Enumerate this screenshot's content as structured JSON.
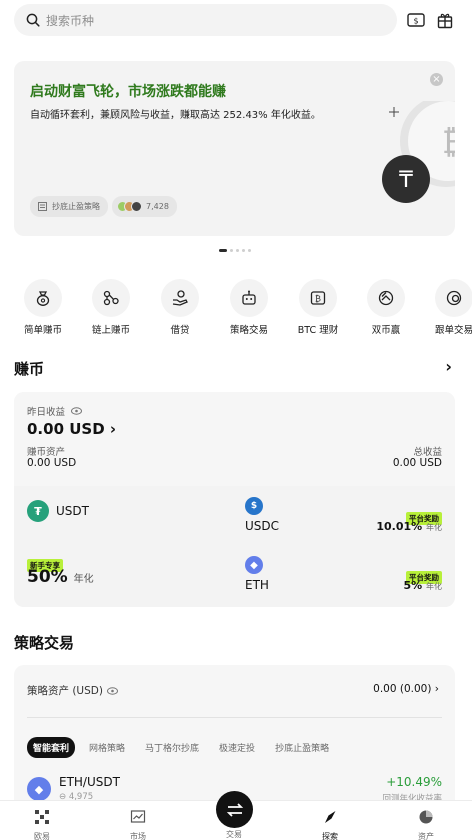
{
  "search": {
    "placeholder": "搜索币种"
  },
  "banner": {
    "title": "启动财富飞轮，市场涨跌都能赚",
    "subtitle": "自动循环套利，兼顾风险与收益，赚取高达 252.43% 年化收益。",
    "chip_label": "抄底止盈策略",
    "participants": "7,428"
  },
  "shortcuts": [
    {
      "label": "简单赚币",
      "icon": "money-bag-icon"
    },
    {
      "label": "链上赚币",
      "icon": "chain-icon"
    },
    {
      "label": "借贷",
      "icon": "loan-hand-icon"
    },
    {
      "label": "策略交易",
      "icon": "robot-icon"
    },
    {
      "label": "BTC 理财",
      "icon": "btc-wallet-icon"
    },
    {
      "label": "双币赢",
      "icon": "dual-coin-icon"
    },
    {
      "label": "跟单交易",
      "icon": "copy-trade-icon"
    }
  ],
  "earn": {
    "section_title": "赚币",
    "yesterday_label": "昨日收益",
    "yesterday_value": "0.00 USD",
    "assets_label": "赚币资产",
    "assets_value": "0.00 USD",
    "total_label": "总收益",
    "total_value": "0.00 USD",
    "products": [
      {
        "coin": "USDT",
        "badge": "新手专享",
        "apr": "50%",
        "apr_suffix": "年化",
        "color": "#26a17b"
      },
      {
        "coin": "USDC",
        "badge": "平台奖励",
        "apr": "10.01%",
        "apr_suffix": "年化",
        "color": "#2775ca"
      },
      {
        "coin": "ETH",
        "badge": "平台奖励",
        "apr": "5%",
        "apr_suffix": "年化",
        "color": "#627eea"
      }
    ]
  },
  "strategy": {
    "section_title": "策略交易",
    "assets_label": "策略资产 (USD)",
    "assets_value": "0.00 (0.00)",
    "tabs": [
      "智能套利",
      "网格策略",
      "马丁格尔抄底",
      "极速定投",
      "抄底止盈策略"
    ],
    "row": {
      "pair": "ETH/USDT",
      "sub": "⊖ 4,975",
      "return": "+10.49%",
      "return_label": "回测年化收益率"
    }
  },
  "nav": [
    {
      "label": "欧易",
      "icon": "home-logo-icon"
    },
    {
      "label": "市场",
      "icon": "chart-icon"
    },
    {
      "label": "交易",
      "icon": "trade-swap-icon"
    },
    {
      "label": "探索",
      "icon": "compass-icon"
    },
    {
      "label": "资产",
      "icon": "pie-icon"
    }
  ],
  "colors": {
    "accent_green": "#2f7a1d",
    "badge_green": "#b8f03a",
    "positive": "#2a9d3a",
    "card_bg": "#f3f3f3"
  }
}
